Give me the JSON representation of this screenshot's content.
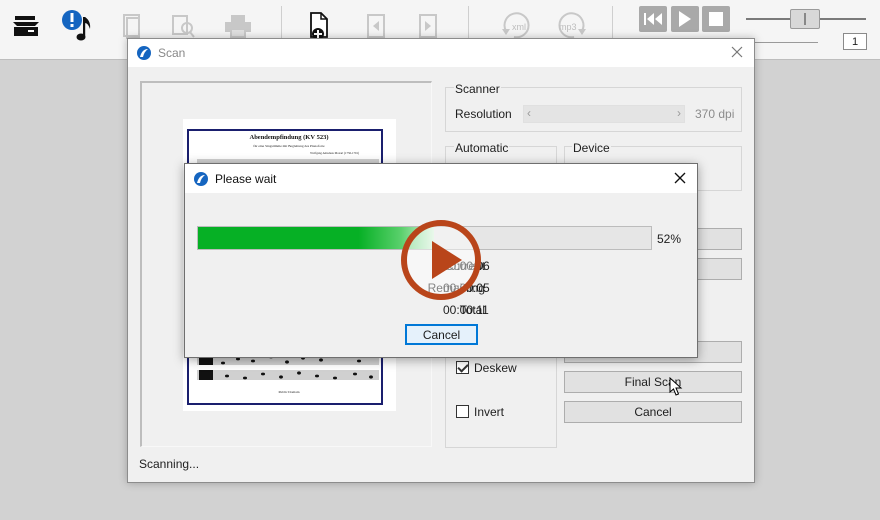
{
  "toolbar": {
    "icons": [
      "scanner-icon",
      "note-alert-icon",
      "document-icon",
      "zoom-icon",
      "printer-icon",
      "new-page-icon",
      "prev-page-icon",
      "next-page-icon",
      "xml-icon",
      "mp3-icon"
    ],
    "xml_label": "xml",
    "mp3_label": "mp3",
    "page_number": "1"
  },
  "scan_window": {
    "title": "Scan",
    "status": "Scanning...",
    "scanner_group": "Scanner",
    "resolution_label": "Resolution",
    "resolution_value": "370 dpi",
    "automatic_group": "Automatic",
    "device_group": "Device",
    "deskew_label": "Deskew",
    "deskew_checked": true,
    "invert_label": "Invert",
    "invert_checked": false,
    "final_scan_button": "Final Scan",
    "cancel_button": "Cancel"
  },
  "preview": {
    "score_title": "Abendempfindung (KV 523)",
    "score_subtitle": "für eine Singstimme mit Begleitung des Pianoforte",
    "composer": "Wolfgang Amadeus Mozart (1756-1791)",
    "footer": "Public Domain"
  },
  "wait_dialog": {
    "title": "Please wait",
    "progress": 0.52,
    "percent_label": "52%",
    "current_label": "Current",
    "current_value": "00:00:06",
    "remaining_label": "Remaining",
    "remaining_value": "00:00:05",
    "total_label": "Total",
    "total_value": "00:00:11",
    "cancel_button": "Cancel"
  },
  "colors": {
    "progress_green": "#06b025",
    "play_overlay": "#b9451a",
    "score_border": "#1a1f6e",
    "focus_blue": "#0078d7"
  }
}
